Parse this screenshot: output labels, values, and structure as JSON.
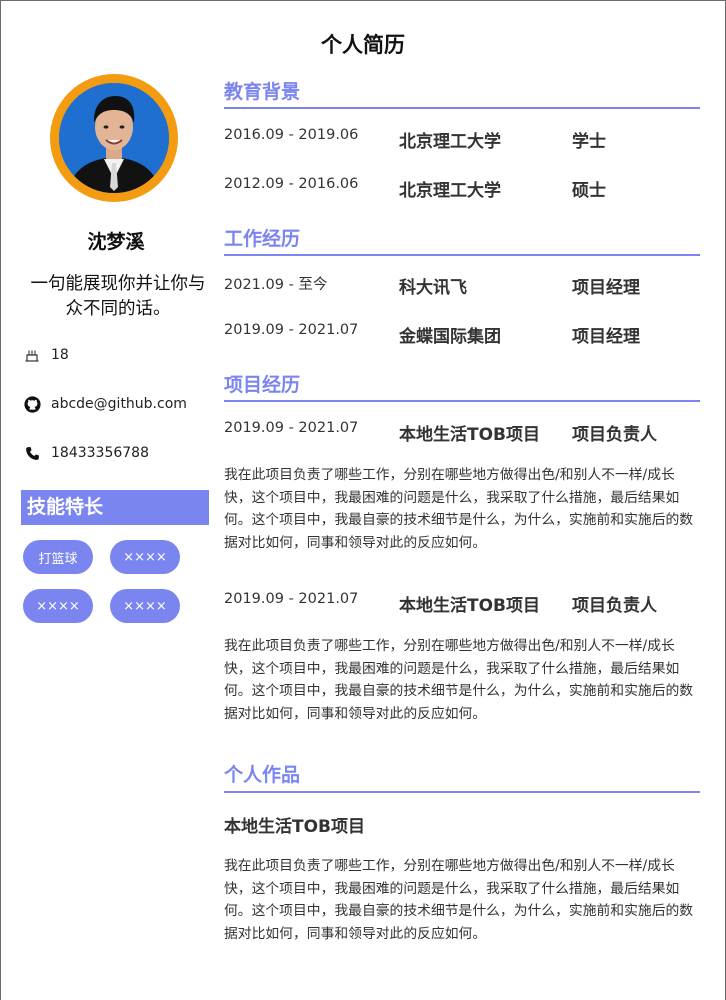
{
  "title": "个人简历",
  "profile": {
    "name": "沈梦溪",
    "motto": "一句能展现你并让你与众不同的话。",
    "age": "18",
    "email": "abcde@github.com",
    "phone": "18433356788"
  },
  "skills": {
    "heading": "技能特长",
    "tags": [
      "打篮球",
      "××××",
      "××××",
      "××××"
    ]
  },
  "education": {
    "heading": "教育背景",
    "items": [
      {
        "date": "2016.09 - 2019.06",
        "school": "北京理工大学",
        "degree": "学士"
      },
      {
        "date": "2012.09 - 2016.06",
        "school": "北京理工大学",
        "degree": "硕士"
      }
    ]
  },
  "work": {
    "heading": "工作经历",
    "items": [
      {
        "date": "2021.09 - 至今",
        "company": "科大讯飞",
        "role": "项目经理"
      },
      {
        "date": "2019.09 - 2021.07",
        "company": "金蝶国际集团",
        "role": "项目经理"
      }
    ]
  },
  "projects": {
    "heading": "项目经历",
    "items": [
      {
        "date": "2019.09 - 2021.07",
        "name": "本地生活TOB项目",
        "role": "项目负责人",
        "description": "我在此项目负责了哪些工作，分别在哪些地方做得出色/和别人不一样/成长快，这个项目中，我最困难的问题是什么，我采取了什么措施，最后结果如何。这个项目中，我最自豪的技术细节是什么，为什么，实施前和实施后的数据对比如何，同事和领导对此的反应如何。"
      },
      {
        "date": "2019.09 - 2021.07",
        "name": "本地生活TOB项目",
        "role": "项目负责人",
        "description": "我在此项目负责了哪些工作，分别在哪些地方做得出色/和别人不一样/成长快，这个项目中，我最困难的问题是什么，我采取了什么措施，最后结果如何。这个项目中，我最自豪的技术细节是什么，为什么，实施前和实施后的数据对比如何，同事和领导对此的反应如何。"
      }
    ]
  },
  "portfolio": {
    "heading": "个人作品",
    "items": [
      {
        "name": "本地生活TOB项目",
        "description": "我在此项目负责了哪些工作，分别在哪些地方做得出色/和别人不一样/成长快，这个项目中，我最困难的问题是什么，我采取了什么措施，最后结果如何。这个项目中，我最自豪的技术细节是什么，为什么，实施前和实施后的数据对比如何，同事和领导对此的反应如何。"
      }
    ]
  },
  "colors": {
    "accent": "#7b85ef",
    "avatar_ring": "#f39c12",
    "avatar_bg": "#1f6fd1"
  },
  "icons": {
    "age": "cake-icon",
    "email": "github-icon",
    "phone": "phone-icon"
  }
}
